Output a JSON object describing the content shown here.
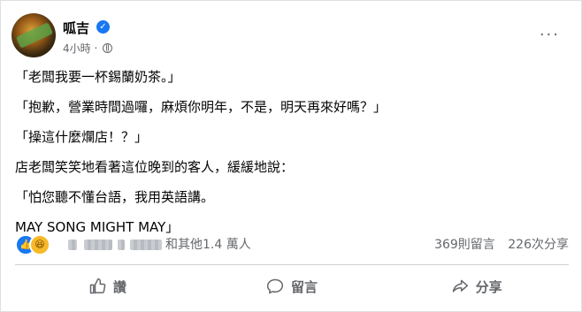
{
  "post": {
    "author": "呱吉",
    "verified_glyph": "✓",
    "time": "4小時",
    "separator": "·",
    "more_glyph": "···"
  },
  "body": {
    "lines": [
      "「老闆我要一杯錫蘭奶茶。」",
      "「抱歉，營業時間過囉，麻煩你明年，不是，明天再來好嗎？」",
      "「操這什麼爛店！？」",
      "店老闆笑笑地看著這位晚到的客人，緩緩地說：",
      "「怕您聽不懂台語，我用英語講。",
      "MAY SONG MIGHT MAY」"
    ]
  },
  "reactions": {
    "like_glyph": "👍",
    "haha_glyph": "😆",
    "others_text": "和其他1.4 萬人",
    "comments": "369則留言",
    "shares": "226次分享"
  },
  "actions": {
    "like": "讚",
    "comment": "留言",
    "share": "分享"
  },
  "colors": {
    "accent": "#1877f2",
    "secondary_text": "#65676b",
    "haha": "#f7b928"
  }
}
